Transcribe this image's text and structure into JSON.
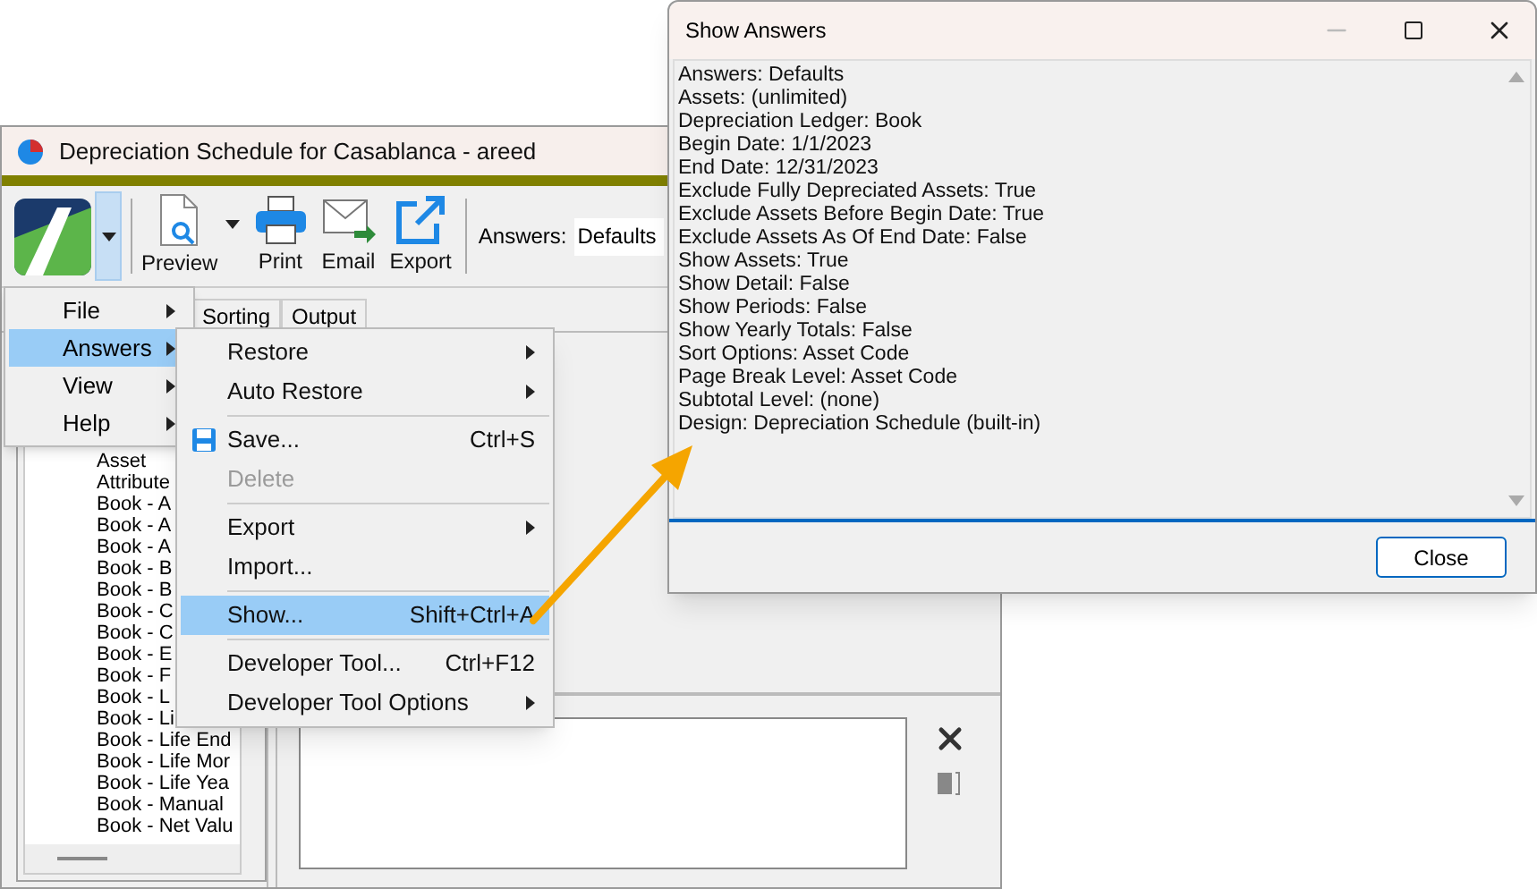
{
  "main_window": {
    "title": "Depreciation Schedule for Casablanca - areed",
    "toolbar": {
      "buttons": [
        {
          "kind": "preview",
          "label": "Preview",
          "dropdown": true
        },
        {
          "kind": "print",
          "label": "Print",
          "dropdown": false
        },
        {
          "kind": "email",
          "label": "Email",
          "dropdown": false
        },
        {
          "kind": "export",
          "label": "Export",
          "dropdown": false
        }
      ],
      "answers_label": "Answers:",
      "answers_value": "Defaults"
    },
    "tabs": [
      {
        "label": "Sorting",
        "selected": false
      },
      {
        "label": "Output",
        "selected": false
      }
    ],
    "tree": [
      "Asset",
      "Attribute",
      "Book - A",
      "Book - A",
      "Book - A",
      "Book - B",
      "Book - B",
      "Book - C",
      "Book - C",
      "Book - E",
      "Book - F",
      "Book - L",
      "Book - Li",
      "Book - Life End",
      "Book - Life Mor",
      "Book - Life Yea",
      "Book - Manual",
      "Book - Net Valu"
    ]
  },
  "app_menu": [
    {
      "label": "File",
      "selected": false
    },
    {
      "label": "Answers",
      "selected": true
    },
    {
      "label": "View",
      "selected": false
    },
    {
      "label": "Help",
      "selected": false
    }
  ],
  "answers_submenu": [
    {
      "kind": "command",
      "label": "Restore",
      "submenu": true,
      "selected": false,
      "disabled": false
    },
    {
      "kind": "command",
      "label": "Auto Restore",
      "submenu": true,
      "selected": false,
      "disabled": false
    },
    {
      "kind": "separator"
    },
    {
      "kind": "save",
      "label": "Save...",
      "shortcut": "Ctrl+S",
      "submenu": false,
      "selected": false,
      "disabled": false
    },
    {
      "kind": "command",
      "label": "Delete",
      "submenu": false,
      "selected": false,
      "disabled": true
    },
    {
      "kind": "separator"
    },
    {
      "kind": "command",
      "label": "Export",
      "submenu": true,
      "selected": false,
      "disabled": false
    },
    {
      "kind": "command",
      "label": "Import...",
      "submenu": false,
      "selected": false,
      "disabled": false
    },
    {
      "kind": "separator"
    },
    {
      "kind": "command",
      "label": "Show...",
      "shortcut": "Shift+Ctrl+A",
      "submenu": false,
      "selected": true,
      "disabled": false
    },
    {
      "kind": "separator"
    },
    {
      "kind": "command",
      "label": "Developer Tool...",
      "shortcut": "Ctrl+F12",
      "submenu": false,
      "selected": false,
      "disabled": false
    },
    {
      "kind": "command",
      "label": "Developer Tool Options",
      "submenu": true,
      "selected": false,
      "disabled": false
    }
  ],
  "dialog": {
    "title": "Show Answers",
    "lines": [
      "Answers: Defaults",
      "Assets: (unlimited)",
      "Depreciation Ledger: Book",
      "Begin Date: 1/1/2023",
      "End Date: 12/31/2023",
      "Exclude Fully Depreciated Assets: True",
      "Exclude Assets Before Begin Date: True",
      "Exclude Assets As Of End Date: False",
      "Show Assets: True",
      "Show Detail: False",
      "Show Periods: False",
      "Show Yearly Totals: False",
      "Sort Options: Asset Code",
      "Page Break Level: Asset Code",
      "Subtotal Level: (none)",
      "Design: Depreciation Schedule (built-in)"
    ],
    "close_button": "Close"
  }
}
